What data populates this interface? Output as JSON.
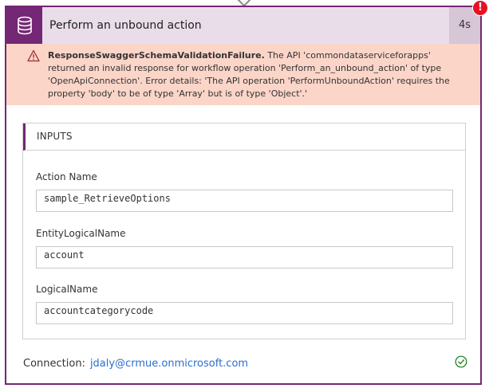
{
  "action": {
    "title": "Perform an unbound action",
    "duration": "4s",
    "icon": "database-icon",
    "accent_color": "#742774",
    "status": "failed"
  },
  "error_badge": {
    "symbol": "!",
    "color": "#e81123"
  },
  "error": {
    "icon": "warning-icon",
    "code": "ResponseSwaggerSchemaValidationFailure.",
    "message": " The API 'commondataserviceforapps' returned an invalid response for workflow operation 'Perform_an_unbound_action' of type 'OpenApiConnection'. Error details: 'The API operation 'PerformUnboundAction' requires the property 'body' to be of type 'Array' but is of type 'Object'.'",
    "background": "#fbd5c8"
  },
  "inputs": {
    "section_title": "INPUTS",
    "fields": [
      {
        "label": "Action Name",
        "value": "sample_RetrieveOptions"
      },
      {
        "label": "EntityLogicalName",
        "value": "account"
      },
      {
        "label": "LogicalName",
        "value": "accountcategorycode"
      }
    ]
  },
  "connection": {
    "label": "Connection:",
    "account": "jdaly@crmue.onmicrosoft.com",
    "status_icon": "check-circle-icon",
    "status_color": "#107c10"
  }
}
